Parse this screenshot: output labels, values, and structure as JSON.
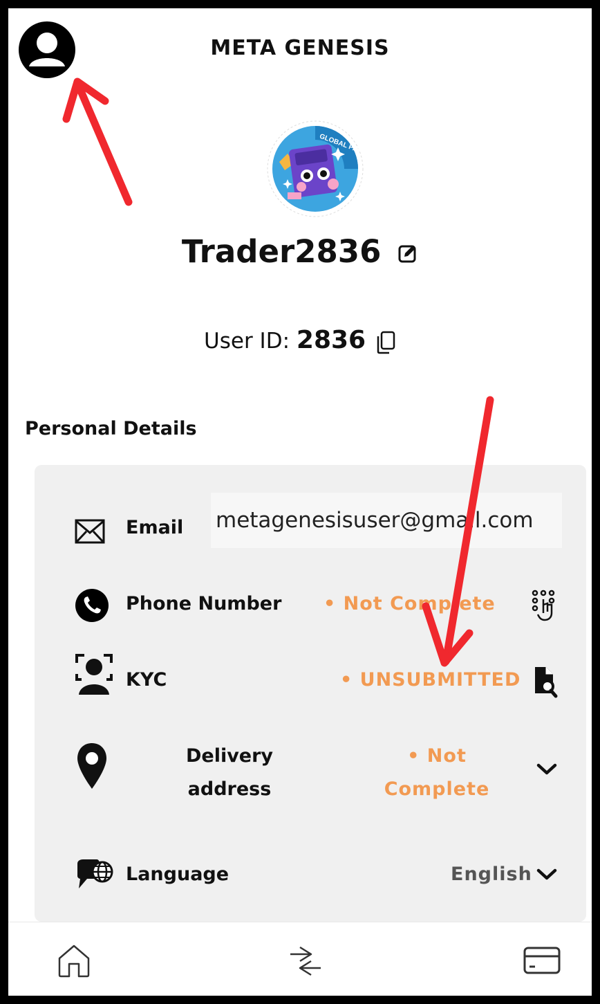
{
  "header": {
    "title": "META GENESIS",
    "avatar_icon": "user-circle-icon"
  },
  "profile": {
    "avatar_badge_text": "GLOBAL PAYMENT",
    "username": "Trader2836",
    "user_id_label": "User ID:",
    "user_id_value": "2836"
  },
  "personal_details": {
    "title": "Personal Details",
    "items": [
      {
        "label": "Email",
        "value": "metagenesisuser@gmail.com",
        "icon": "envelope-icon"
      },
      {
        "label": "Phone Number",
        "status": "• Not Complete",
        "icon": "phone-icon",
        "action_icon": "keypad-hand-icon"
      },
      {
        "label": "KYC",
        "status": "• UNSUBMITTED",
        "icon": "face-scan-icon",
        "action_icon": "document-search-icon"
      },
      {
        "label_line1": "Delivery",
        "label_line2": "address",
        "status_line1": "• Not",
        "status_line2": "Complete",
        "icon": "location-pin-icon",
        "action_icon": "chevron-down-icon"
      },
      {
        "label": "Language",
        "value": "English",
        "icon": "globe-chat-icon",
        "action_icon": "chevron-down-icon"
      }
    ]
  },
  "bottom_nav": {
    "items": [
      {
        "name": "home",
        "icon": "home-icon"
      },
      {
        "name": "swap",
        "icon": "swap-arrows-icon"
      },
      {
        "name": "card",
        "icon": "card-icon"
      }
    ]
  },
  "colors": {
    "status": "#f29a52",
    "card_bg": "#f0f0f0",
    "annotation_arrow": "#f0282e"
  }
}
